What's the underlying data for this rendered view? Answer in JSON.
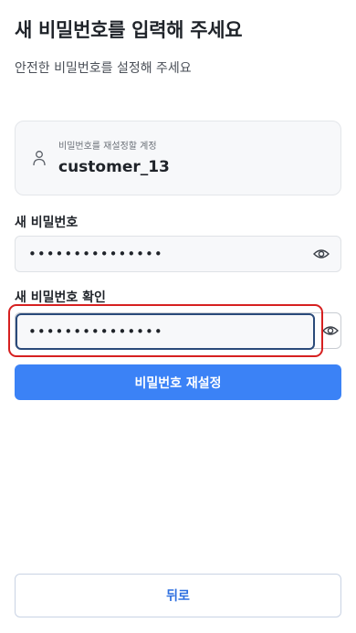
{
  "header": {
    "title": "새 비밀번호를 입력해 주세요",
    "subtitle": "안전한 비밀번호를 설정해 주세요"
  },
  "account": {
    "label": "비밀번호를 재설정할 계정",
    "value": "customer_13",
    "icon": "person-icon"
  },
  "new_password": {
    "label": "새 비밀번호",
    "value": "•••••••••••••••",
    "toggle_icon": "eye-icon"
  },
  "confirm_password": {
    "label": "새 비밀번호 확인",
    "value": "•••••••••••••••",
    "toggle_icon": "eye-icon"
  },
  "buttons": {
    "reset_label": "비밀번호 재설정",
    "back_label": "뒤로"
  },
  "colors": {
    "primary": "#3b82f6",
    "highlight": "#d62020",
    "back_text": "#2e6fe0"
  }
}
